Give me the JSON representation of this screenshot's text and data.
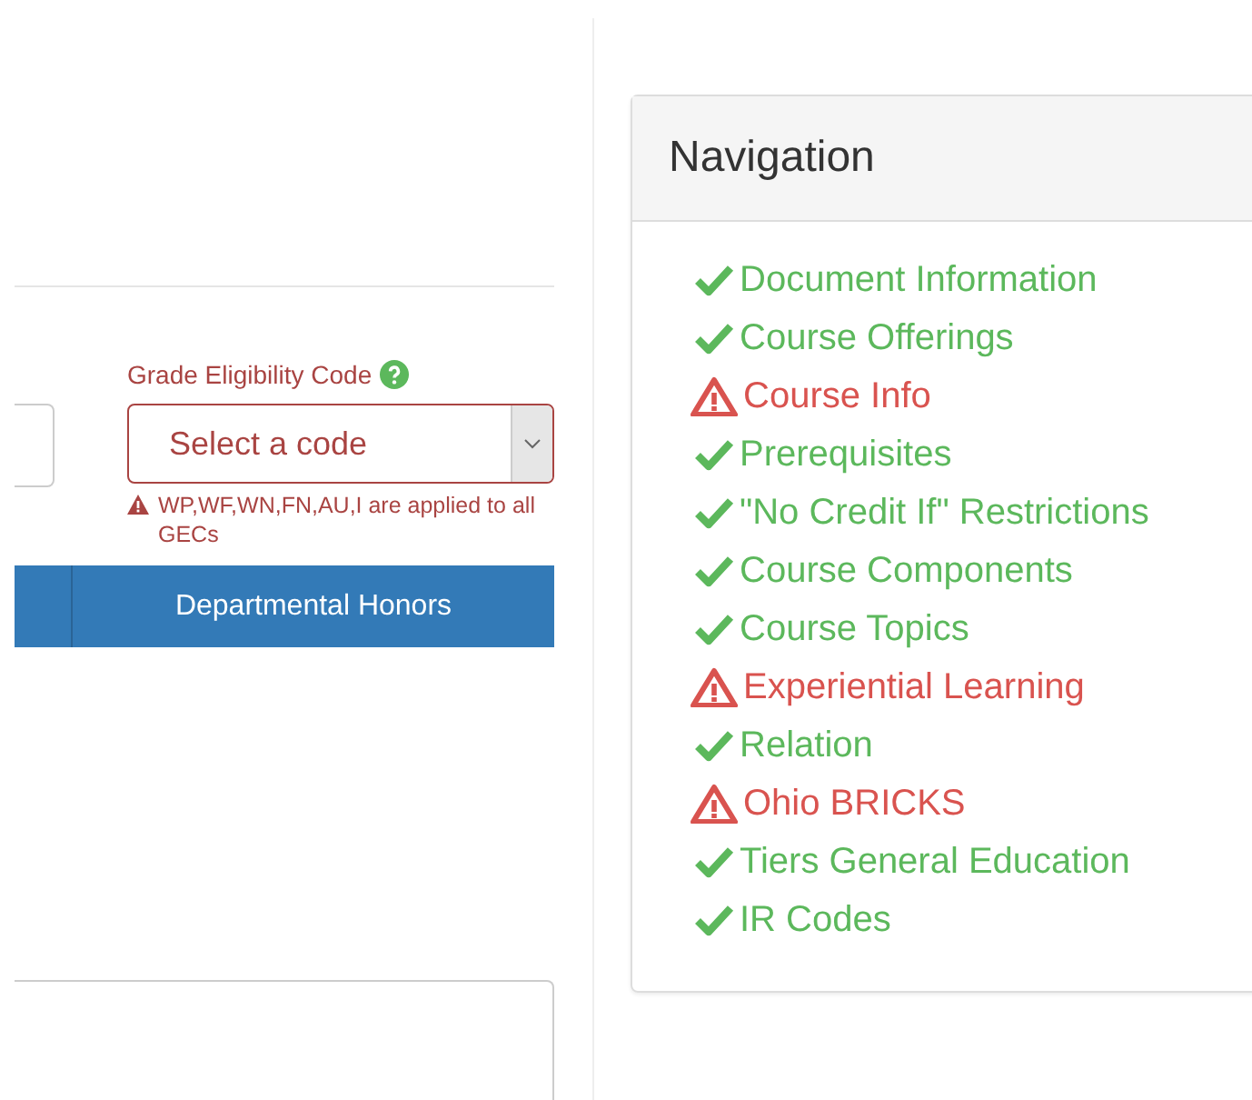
{
  "grade_field": {
    "label": "Grade Eligibility Code",
    "placeholder": "Select a code",
    "invalid": true,
    "error": "WP,WF,WN,FN,AU,I are applied to all GECs"
  },
  "buttons": [
    {
      "label": "Departmental Honors"
    }
  ],
  "navigation": {
    "title": "Navigation",
    "items": [
      {
        "label": "Document Information",
        "kind": "ok"
      },
      {
        "label": "Course Offerings",
        "kind": "ok"
      },
      {
        "label": "Course Info",
        "kind": "warning"
      },
      {
        "label": "Prerequisites",
        "kind": "ok"
      },
      {
        "label": "\"No Credit If\" Restrictions",
        "kind": "ok"
      },
      {
        "label": "Course Components",
        "kind": "ok"
      },
      {
        "label": "Course Topics",
        "kind": "ok"
      },
      {
        "label": "Experiential Learning",
        "kind": "warning"
      },
      {
        "label": "Relation",
        "kind": "ok"
      },
      {
        "label": "Ohio BRICKS",
        "kind": "warning"
      },
      {
        "label": "Tiers General Education",
        "kind": "ok"
      },
      {
        "label": "IR Codes",
        "kind": "ok"
      }
    ]
  }
}
